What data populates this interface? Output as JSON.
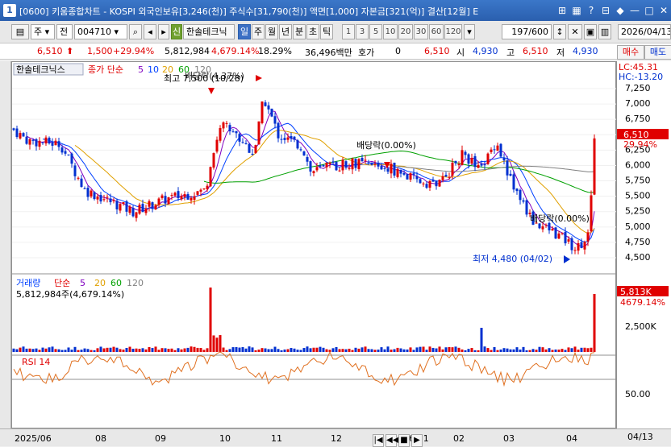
{
  "window": {
    "title": "[0600] 키움종합차트 - KOSPI 외국인보유[3,246(천)] 주식수[31,790(천)] 액면[1,000] 자본금[321(억)] 결산[12월] E",
    "number": "1"
  },
  "toolbar": {
    "market": "주",
    "mode": "전",
    "code": "004710",
    "new_badge": "신",
    "stock_name": "한솔테크닉",
    "periods": [
      "일",
      "주",
      "월",
      "년",
      "분",
      "초",
      "틱"
    ],
    "selected_period": "일",
    "intervals": [
      "1",
      "3",
      "5",
      "10",
      "20",
      "30",
      "60",
      "120"
    ],
    "count": "197/600",
    "date": "2026/04/13"
  },
  "quote": {
    "price": "6,510",
    "change": "1,500",
    "change_pct": "+29.94%",
    "volume": "5,812,984",
    "volume_ratio": "4,679.14%",
    "turnover": "18.29%",
    "amount": "36,496백만",
    "hoga_label": "호가",
    "hoga_value": "0",
    "ask": "6,510",
    "open_label": "시",
    "open": "4,930",
    "high_label": "고",
    "high": "6,510",
    "low_label": "저",
    "low": "4,930",
    "buy_button": "매수",
    "sell_button": "매도"
  },
  "price_panel": {
    "legend_name": "한솔테크닉스",
    "legend_price": "종가 단순",
    "ma": [
      "5",
      "10",
      "20",
      "60",
      "120"
    ],
    "ma_colors": [
      "#8000c0",
      "#0040ff",
      "#e0a000",
      "#00a000",
      "#808080"
    ],
    "annotation_high": "최고 7,500 (10/28)",
    "annotation_overlay": "배당락(4.37%)",
    "annotation_div1": "배당락(0.00%)",
    "annotation_div2": "배당락(0.00%)",
    "annotation_low": "최저 4,480 (04/02)",
    "lc": "LC:45.31",
    "hc": "HC:-13.20",
    "current_price_tag": "6,510",
    "current_pct_tag": "29.94%",
    "y_ticks": [
      "7,250",
      "7,000",
      "6,750",
      "6,500",
      "6,250",
      "6,000",
      "5,750",
      "5,500",
      "5,250",
      "5,000",
      "4,750",
      "4,500"
    ]
  },
  "volume_panel": {
    "legend_name": "거래량",
    "legend_ma": "단순",
    "ma": [
      "5",
      "20",
      "60",
      "120"
    ],
    "volume_text": "5,812,984주(4,679.14%)",
    "current_tag": "5,813K",
    "current_pct": "4679.14%",
    "y_ticks": [
      "2,500K"
    ]
  },
  "rsi_panel": {
    "legend_name": "RSI 14",
    "y_ticks": [
      "50.00"
    ]
  },
  "x_axis": {
    "labels": [
      "2025/06",
      "08",
      "09",
      "10",
      "11",
      "12",
      "2026/01",
      "02",
      "03",
      "04"
    ],
    "right_label": "04/13"
  }
}
